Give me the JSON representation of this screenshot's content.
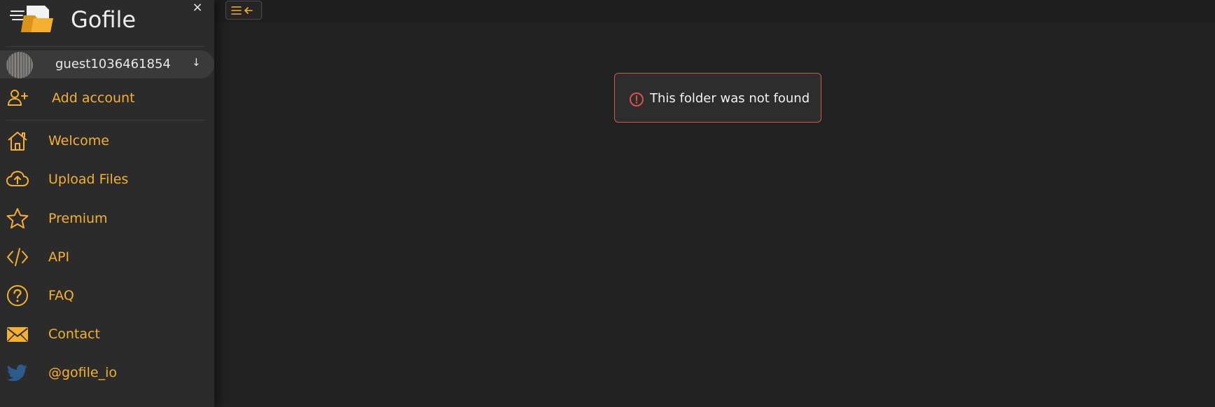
{
  "brand": {
    "name": "Gofile",
    "close_symbol": "×"
  },
  "account": {
    "username": "guest1036461854",
    "caret": "↓"
  },
  "add_account": {
    "label": "Add account",
    "icon": "user-plus-icon"
  },
  "nav": [
    {
      "label": "Welcome",
      "icon": "home-icon"
    },
    {
      "label": "Upload Files",
      "icon": "cloud-upload-icon"
    },
    {
      "label": "Premium",
      "icon": "star-icon"
    },
    {
      "label": "API",
      "icon": "code-icon"
    },
    {
      "label": "FAQ",
      "icon": "question-circle-icon"
    },
    {
      "label": "Contact",
      "icon": "envelope-icon"
    },
    {
      "label": "@gofile_io",
      "icon": "twitter-icon"
    }
  ],
  "alert": {
    "message": "This folder was not found",
    "icon": "exclamation-circle-icon",
    "border_color": "#d6544b"
  },
  "colors": {
    "accent": "#f5b031",
    "sidebar_bg": "#2b2b2b",
    "main_bg": "#222222",
    "twitter_blue": "#2c5a8a"
  }
}
